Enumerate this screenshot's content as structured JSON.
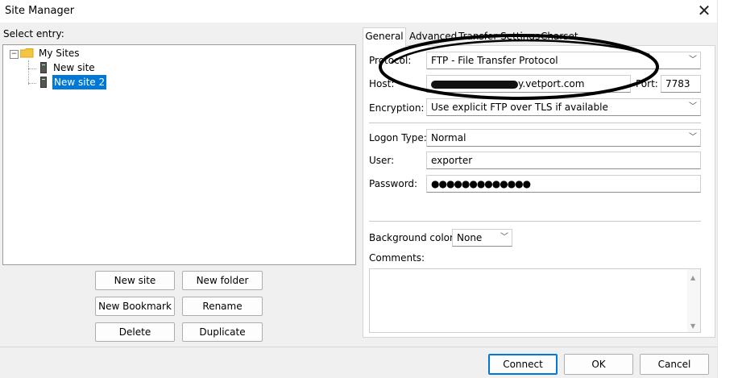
{
  "window": {
    "title": "Site Manager"
  },
  "left": {
    "select_entry_label": "Select entry:",
    "tree": {
      "root": "My Sites",
      "items": [
        "New site",
        "New site 2"
      ],
      "selected_index": 1
    },
    "buttons": {
      "new_site": "New site",
      "new_folder": "New folder",
      "new_bookmark": "New Bookmark",
      "rename": "Rename",
      "delete": "Delete",
      "duplicate": "Duplicate"
    }
  },
  "tabs": {
    "general": "General",
    "advanced": "Advanced",
    "transfer_settings": "Transfer Settings",
    "charset": "Charset"
  },
  "general": {
    "protocol_label": "Protocol:",
    "protocol_value": "FTP - File Transfer Protocol",
    "host_label": "Host:",
    "host_value": "y.vetport.com",
    "port_label": "Port:",
    "port_value": "7783",
    "encryption_label": "Encryption:",
    "encryption_value": "Use explicit FTP over TLS if available",
    "logon_type_label": "Logon Type:",
    "logon_type_value": "Normal",
    "user_label": "User:",
    "user_value": "exporter",
    "password_label": "Password:",
    "password_value": "●●●●●●●●●●●●●",
    "background_color_label": "Background color:",
    "background_color_value": "None",
    "comments_label": "Comments:"
  },
  "footer": {
    "connect": "Connect",
    "ok": "OK",
    "cancel": "Cancel"
  },
  "colors": {
    "selection": "#0078d7",
    "annotation_ellipse": "#000000",
    "redaction": "#111111"
  }
}
